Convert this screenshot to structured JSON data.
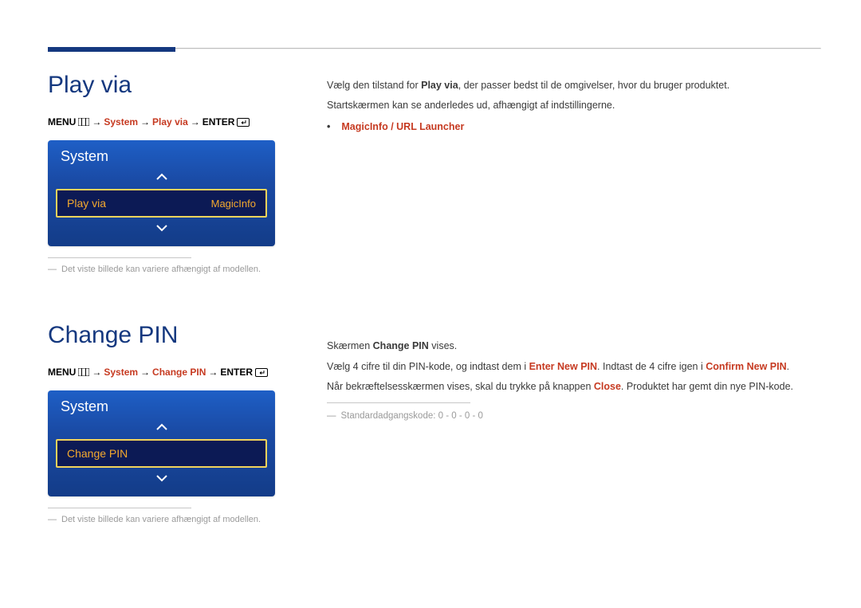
{
  "section1": {
    "title": "Play via",
    "path": {
      "p1": "MENU",
      "p2": "System",
      "p3": "Play via",
      "p4": "ENTER"
    },
    "box": {
      "header": "System",
      "item_label": "Play via",
      "item_value": "MagicInfo"
    },
    "note": "Det viste billede kan variere afhængigt af modellen."
  },
  "section2": {
    "title": "Change PIN",
    "path": {
      "p1": "MENU",
      "p2": "System",
      "p3": "Change PIN",
      "p4": "ENTER"
    },
    "box": {
      "header": "System",
      "item_label": "Change PIN"
    },
    "note": "Det viste billede kan variere afhængigt af modellen."
  },
  "right1": {
    "p1a": "Vælg den tilstand for ",
    "p1b": "Play via",
    "p1c": ", der passer bedst til de omgivelser, hvor du bruger produktet.",
    "p2": "Startskærmen kan se anderledes ud, afhængigt af indstillingerne.",
    "bullet1": "MagicInfo / URL Launcher"
  },
  "right2": {
    "p1a": "Skærmen ",
    "p1b": "Change PIN",
    "p1c": " vises.",
    "p2a": "Vælg 4 cifre til din PIN-kode, og indtast dem i ",
    "p2b": "Enter New PIN",
    "p2c": ". Indtast de 4 cifre igen i ",
    "p2d": "Confirm New PIN",
    "p2e": ".",
    "p3a": "Når bekræftelsesskærmen vises, skal du trykke på knappen ",
    "p3b": "Close",
    "p3c": ". Produktet har gemt din nye PIN-kode.",
    "info": "Standardadgangskode: 0 - 0 - 0 - 0"
  }
}
